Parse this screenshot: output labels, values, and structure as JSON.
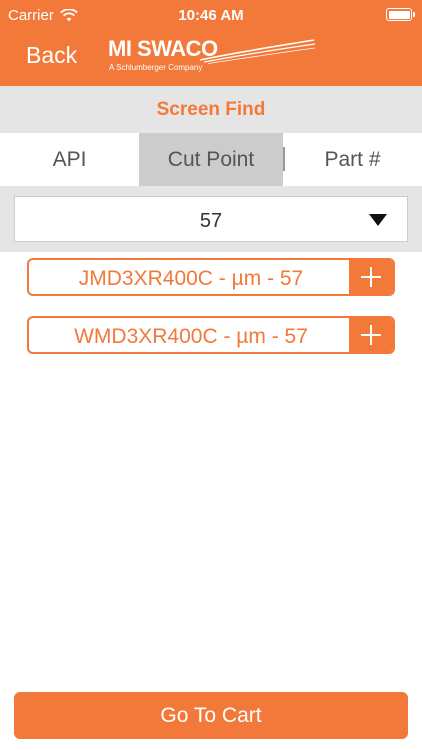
{
  "status_bar": {
    "carrier": "Carrier",
    "time": "10:46 AM"
  },
  "nav": {
    "back_label": "Back",
    "logo_text": "MI SWACO",
    "logo_tagline": "A Schlumberger Company"
  },
  "title": "Screen Find",
  "tabs": [
    {
      "label": "API",
      "selected": false
    },
    {
      "label": "Cut Point",
      "selected": true
    },
    {
      "label": "Part #",
      "selected": false
    }
  ],
  "filter": {
    "selected_value": "57"
  },
  "results": [
    {
      "label": "JMD3XR400C - µm - 57"
    },
    {
      "label": "WMD3XR400C - µm - 57"
    }
  ],
  "cart_button_label": "Go To Cart",
  "colors": {
    "accent": "#f2793a",
    "panel": "#e5e5e5",
    "selected_tab": "#cccccc"
  }
}
